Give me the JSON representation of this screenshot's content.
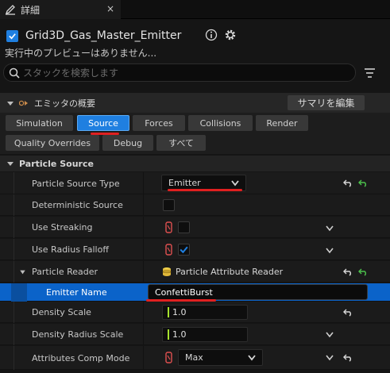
{
  "tab": {
    "title": "詳細",
    "close": "×"
  },
  "header": {
    "emitter_name": "Grid3D_Gas_Master_Emitter",
    "preview_status": "実行中のプレビューはありません..."
  },
  "search": {
    "placeholder": "スタックを検索します"
  },
  "category": {
    "label": "エミッタの概要",
    "summary_button": "サマリを編集"
  },
  "filters": {
    "simulation": "Simulation",
    "source": "Source",
    "forces": "Forces",
    "collisions": "Collisions",
    "render": "Render",
    "quality_overrides": "Quality Overrides",
    "debug": "Debug",
    "all": "すべて",
    "active": "Source"
  },
  "section": {
    "label": "Particle Source"
  },
  "properties": {
    "particle_source_type": {
      "label": "Particle Source Type",
      "value": "Emitter"
    },
    "deterministic_source": {
      "label": "Deterministic Source",
      "checked": false
    },
    "use_streaking": {
      "label": "Use Streaking",
      "checked": false
    },
    "use_radius_falloff": {
      "label": "Use Radius Falloff",
      "checked": true
    },
    "particle_reader": {
      "label": "Particle Reader",
      "value": "Particle Attribute Reader"
    },
    "emitter_name": {
      "label": "Emitter Name",
      "value": "ConfettiBurst"
    },
    "density_scale": {
      "label": "Density Scale",
      "value": "1.0"
    },
    "density_radius_scale": {
      "label": "Density Radius Scale",
      "value": "1.0"
    },
    "attributes_comp_mode": {
      "label": "Attributes Comp Mode",
      "value": "Max"
    }
  },
  "colors": {
    "accent": "#1f7fe0",
    "selected_row": "#0b63c9",
    "annotation": "#e02020",
    "reset_green": "#4cc24c"
  }
}
